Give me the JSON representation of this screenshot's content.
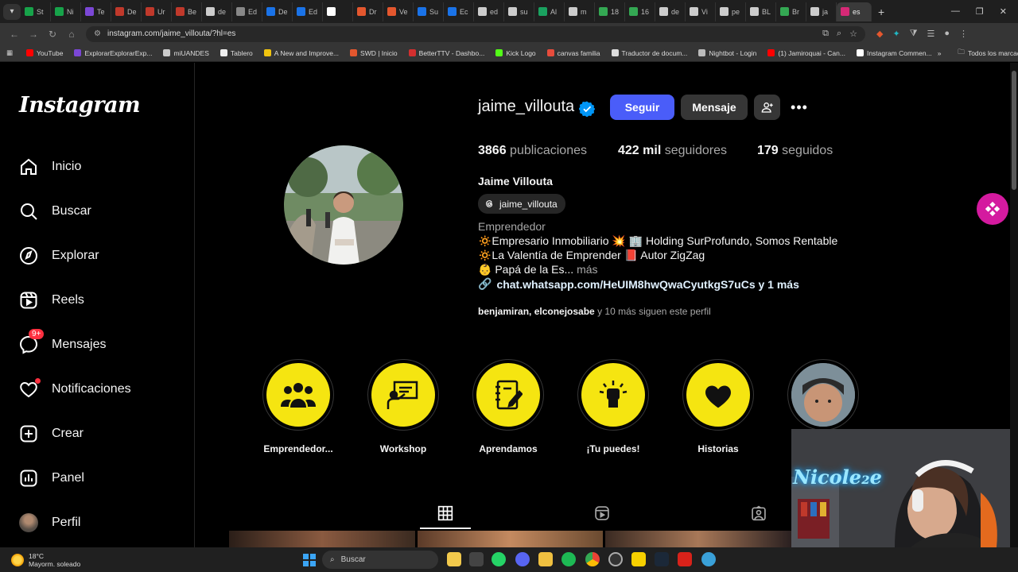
{
  "browser": {
    "tabs": [
      {
        "label": "St",
        "color": "#17a34a"
      },
      {
        "label": "Ni",
        "color": "#17a34a"
      },
      {
        "label": "Te",
        "color": "#7b47d6"
      },
      {
        "label": "De",
        "color": "#c0392b"
      },
      {
        "label": "Ur",
        "color": "#c0392b"
      },
      {
        "label": "Be",
        "color": "#c0392b"
      },
      {
        "label": "de",
        "color": "#cccccc"
      },
      {
        "label": "Ed",
        "color": "#888888"
      },
      {
        "label": "De",
        "color": "#1a73e8"
      },
      {
        "label": "Ed",
        "color": "#1a73e8"
      },
      {
        "label": "",
        "color": "#ffffff"
      },
      {
        "label": "Dr",
        "color": "#e4572e"
      },
      {
        "label": "Ve",
        "color": "#e4572e"
      },
      {
        "label": "Su",
        "color": "#1a73e8"
      },
      {
        "label": "Ec",
        "color": "#1a73e8"
      },
      {
        "label": "ed",
        "color": "#cccccc"
      },
      {
        "label": "su",
        "color": "#cccccc"
      },
      {
        "label": "Al",
        "color": "#1aa260"
      },
      {
        "label": "m",
        "color": "#cccccc"
      },
      {
        "label": "18",
        "color": "#34a853"
      },
      {
        "label": "16",
        "color": "#34a853"
      },
      {
        "label": "de",
        "color": "#cccccc"
      },
      {
        "label": "Vi",
        "color": "#cccccc"
      },
      {
        "label": "pe",
        "color": "#cccccc"
      },
      {
        "label": "BL",
        "color": "#cccccc"
      },
      {
        "label": "Br",
        "color": "#34a853"
      },
      {
        "label": "ja",
        "color": "#cccccc"
      },
      {
        "label": "es",
        "color": "#d62976"
      }
    ],
    "url": "instagram.com/jaime_villouta/?hl=es",
    "bookmarks": [
      {
        "label": "YouTube",
        "color": "#ff0000"
      },
      {
        "label": "ExplorarExplorarExp...",
        "color": "#7b47d6"
      },
      {
        "label": "miUANDES",
        "color": "#cccccc"
      },
      {
        "label": "Tablero",
        "color": "#eeeeee"
      },
      {
        "label": "A New and Improve...",
        "color": "#f1c40f"
      },
      {
        "label": "SWD | Inicio",
        "color": "#e4572e"
      },
      {
        "label": "BetterTTV - Dashbo...",
        "color": "#d32f2f"
      },
      {
        "label": "Kick Logo",
        "color": "#53fc18"
      },
      {
        "label": "canvas familia",
        "color": "#e74c3c"
      },
      {
        "label": "Traductor de docum...",
        "color": "#dddddd"
      },
      {
        "label": "Nightbot - Login",
        "color": "#bbbbbb"
      },
      {
        "label": "(1) Jamiroquai - Can...",
        "color": "#ff0000"
      },
      {
        "label": "Instagram Commen...",
        "color": "#ffffff"
      }
    ],
    "bookmarks_folder": "Todos los marcadores"
  },
  "sidebar": {
    "logo": "Instagram",
    "items": [
      {
        "label": "Inicio",
        "icon": "home-icon"
      },
      {
        "label": "Buscar",
        "icon": "search-icon"
      },
      {
        "label": "Explorar",
        "icon": "compass-icon"
      },
      {
        "label": "Reels",
        "icon": "reels-icon"
      },
      {
        "label": "Mensajes",
        "icon": "messenger-icon",
        "badge": "9+"
      },
      {
        "label": "Notificaciones",
        "icon": "heart-icon"
      },
      {
        "label": "Crear",
        "icon": "plus-square-icon"
      },
      {
        "label": "Panel",
        "icon": "chart-icon"
      },
      {
        "label": "Perfil",
        "icon": "avatar-icon"
      }
    ]
  },
  "profile": {
    "username": "jaime_villouta",
    "follow_label": "Seguir",
    "message_label": "Mensaje",
    "posts_count": "3866",
    "posts_label": "publicaciones",
    "followers_count": "422 mil",
    "followers_label": "seguidores",
    "following_count": "179",
    "following_label": "seguidos",
    "full_name": "Jaime Villouta",
    "threads_handle": "jaime_villouta",
    "category": "Emprendedor",
    "bio": {
      "line1": "🔅Empresario Inmobiliario 💥 🏢 Holding SurProfundo, Somos Rentable",
      "line2": "🔅La Valentía de Emprender 📕 Autor ZigZag",
      "line3": "👶 Papá de la Es...",
      "more": "más"
    },
    "link": "chat.whatsapp.com/HeUIM8hwQwaCyutkgS7uCs y 1 más",
    "followed_by_names": "benjamiran, elconejosabe",
    "followed_by_rest": "y 10 más siguen este perfil"
  },
  "highlights": [
    {
      "label": "Emprendedor...",
      "icon": "group-icon"
    },
    {
      "label": "Workshop",
      "icon": "presenter-icon"
    },
    {
      "label": "Aprendamos",
      "icon": "notebook-icon"
    },
    {
      "label": "¡Tu puedes!",
      "icon": "fist-icon"
    },
    {
      "label": "Historias",
      "icon": "heart-icon"
    },
    {
      "label": "",
      "icon": "photo"
    }
  ],
  "webcam": {
    "overlay_text": "Nicole₂e"
  },
  "taskbar": {
    "temperature": "18°C",
    "weather": "Mayorm. soleado",
    "search": "Buscar"
  },
  "colors": {
    "accent": "#4a5df9",
    "highlight": "#f5e511",
    "badge": "#ff3040",
    "verified": "#0095f6"
  }
}
